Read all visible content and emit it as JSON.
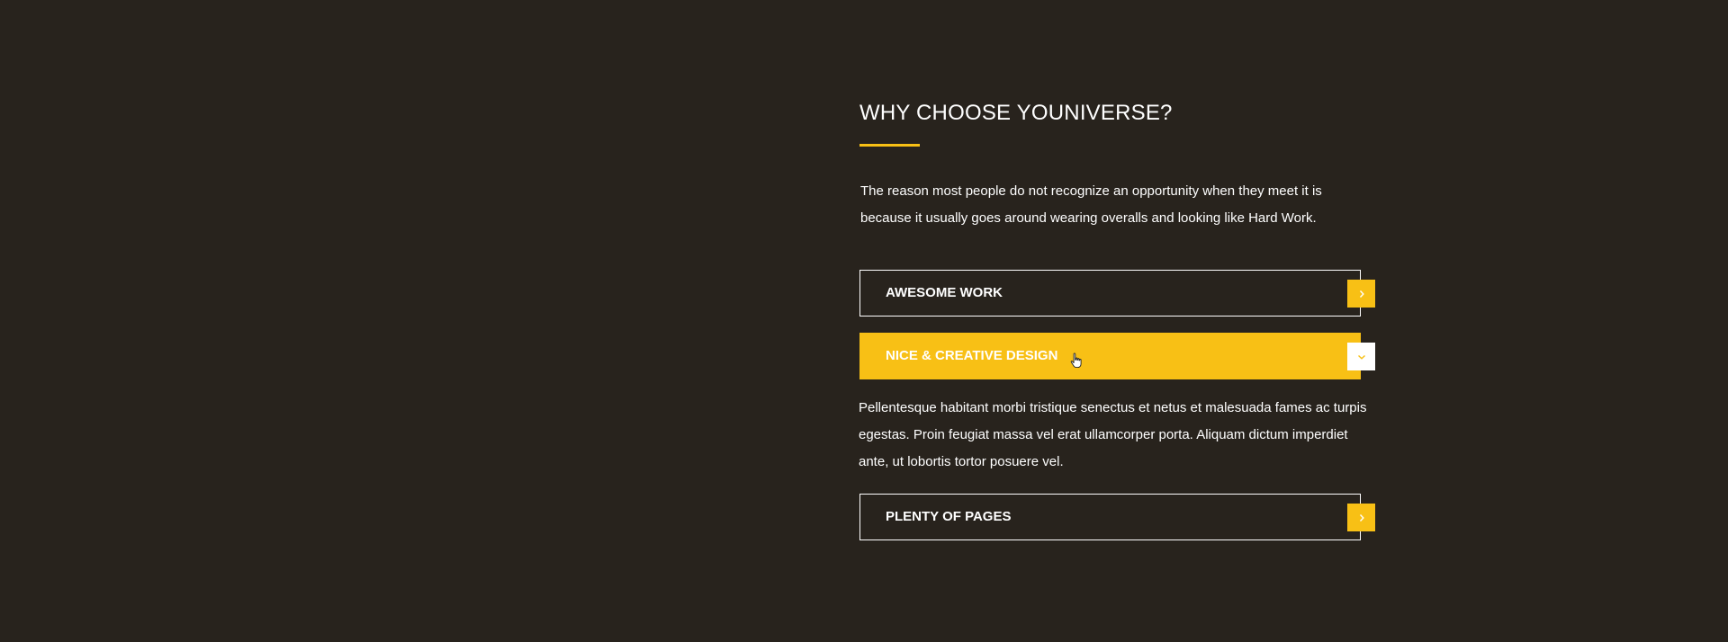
{
  "section": {
    "title": "WHY CHOOSE YOUNIVERSE?",
    "intro": "The reason most people do not recognize an opportunity when they meet it is because it usually goes around wearing overalls and looking like Hard Work."
  },
  "accordion": {
    "items": [
      {
        "label": "AWESOME WORK",
        "state": "collapsed",
        "toggle_icon": "chevron-right-icon"
      },
      {
        "label": "NICE & CREATIVE DESIGN",
        "state": "expanded",
        "toggle_icon": "chevron-down-icon",
        "content": "Pellentesque habitant morbi tristique senectus et netus et malesuada fames ac turpis egestas. Proin feugiat massa vel erat ullamcorper porta. Aliquam dictum imperdiet ante, ut lobortis tortor posuere vel."
      },
      {
        "label": "PLENTY OF PAGES",
        "state": "collapsed",
        "toggle_icon": "chevron-right-icon"
      }
    ]
  },
  "colors": {
    "background": "#28231d",
    "accent": "#f8c015",
    "text": "#ffffff"
  }
}
